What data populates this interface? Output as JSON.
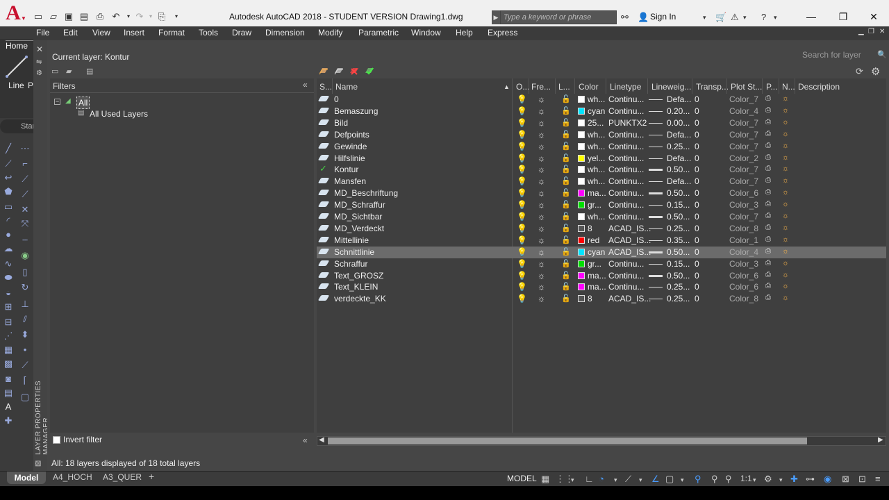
{
  "app": {
    "title": "Autodesk AutoCAD 2018 - STUDENT VERSION    Drawing1.dwg",
    "search_placeholder": "Type a keyword or phrase",
    "sign_in": "Sign In"
  },
  "menu": [
    "File",
    "Edit",
    "View",
    "Insert",
    "Format",
    "Tools",
    "Draw",
    "Dimension",
    "Modify",
    "Parametric",
    "Window",
    "Help",
    "Express"
  ],
  "ribbon": {
    "home_tab": "Home",
    "line_label": "Line",
    "p_label": "P",
    "start_tab": "Star"
  },
  "palette_title": "LAYER PROPERTIES MANAGER",
  "current_layer": "Current layer: Kontur",
  "layer_search_placeholder": "Search for layer",
  "filters": {
    "header": "Filters",
    "all": "All",
    "all_used": "All Used Layers",
    "invert_label": "Invert filter"
  },
  "columns": [
    "S...",
    "Name",
    "O...",
    "Fre...",
    "L...",
    "Color",
    "Linetype",
    "Lineweig...",
    "Transp...",
    "Plot St...",
    "P...",
    "N...",
    "Description"
  ],
  "layers": [
    {
      "name": "0",
      "color": "wh...",
      "hex": "#ffffff",
      "linetype": "Continu...",
      "lineweight": "Defa...",
      "thick": false,
      "transp": "0",
      "plot": "Color_7"
    },
    {
      "name": "Bemaszung",
      "color": "cyan",
      "hex": "#00e5ff",
      "linetype": "Continu...",
      "lineweight": "0.20...",
      "thick": false,
      "transp": "0",
      "plot": "Color_4"
    },
    {
      "name": "Bild",
      "color": "25...",
      "hex": "#ffffff",
      "linetype": "PUNKTX2",
      "lineweight": "0.00...",
      "thick": false,
      "transp": "0",
      "plot": "Color_7"
    },
    {
      "name": "Defpoints",
      "color": "wh...",
      "hex": "#ffffff",
      "linetype": "Continu...",
      "lineweight": "Defa...",
      "thick": false,
      "transp": "0",
      "plot": "Color_7"
    },
    {
      "name": "Gewinde",
      "color": "wh...",
      "hex": "#ffffff",
      "linetype": "Continu...",
      "lineweight": "0.25...",
      "thick": false,
      "transp": "0",
      "plot": "Color_7"
    },
    {
      "name": "Hilfslinie",
      "color": "yel...",
      "hex": "#ffff00",
      "linetype": "Continu...",
      "lineweight": "Defa...",
      "thick": false,
      "transp": "0",
      "plot": "Color_2"
    },
    {
      "name": "Kontur",
      "color": "wh...",
      "hex": "#ffffff",
      "linetype": "Continu...",
      "lineweight": "0.50...",
      "thick": true,
      "transp": "0",
      "plot": "Color_7",
      "current": true
    },
    {
      "name": "Mansfen",
      "color": "wh...",
      "hex": "#ffffff",
      "linetype": "Continu...",
      "lineweight": "Defa...",
      "thick": false,
      "transp": "0",
      "plot": "Color_7"
    },
    {
      "name": "MD_Beschriftung",
      "color": "ma...",
      "hex": "#ff00ff",
      "linetype": "Continu...",
      "lineweight": "0.50...",
      "thick": true,
      "transp": "0",
      "plot": "Color_6"
    },
    {
      "name": "MD_Schraffur",
      "color": "gr...",
      "hex": "#00e000",
      "linetype": "Continu...",
      "lineweight": "0.15...",
      "thick": false,
      "transp": "0",
      "plot": "Color_3"
    },
    {
      "name": "MD_Sichtbar",
      "color": "wh...",
      "hex": "#ffffff",
      "linetype": "Continu...",
      "lineweight": "0.50...",
      "thick": true,
      "transp": "0",
      "plot": "Color_7"
    },
    {
      "name": "MD_Verdeckt",
      "color": "8",
      "hex": "#555555",
      "linetype": "ACAD_IS...",
      "lineweight": "0.25...",
      "thick": false,
      "transp": "0",
      "plot": "Color_8"
    },
    {
      "name": "Mittellinie",
      "color": "red",
      "hex": "#ff0000",
      "linetype": "ACAD_IS...",
      "lineweight": "0.35...",
      "thick": false,
      "transp": "0",
      "plot": "Color_1"
    },
    {
      "name": "Schnittlinie",
      "color": "cyan",
      "hex": "#00e5ff",
      "linetype": "ACAD_IS...",
      "lineweight": "0.50...",
      "thick": true,
      "transp": "0",
      "plot": "Color_4",
      "selected": true
    },
    {
      "name": "Schraffur",
      "color": "gr...",
      "hex": "#00e000",
      "linetype": "Continu...",
      "lineweight": "0.15...",
      "thick": false,
      "transp": "0",
      "plot": "Color_3"
    },
    {
      "name": "Text_GROSZ",
      "color": "ma...",
      "hex": "#ff00ff",
      "linetype": "Continu...",
      "lineweight": "0.50...",
      "thick": true,
      "transp": "0",
      "plot": "Color_6"
    },
    {
      "name": "Text_KLEIN",
      "color": "ma...",
      "hex": "#ff00ff",
      "linetype": "Continu...",
      "lineweight": "0.25...",
      "thick": false,
      "transp": "0",
      "plot": "Color_6"
    },
    {
      "name": "verdeckte_KK",
      "color": "8",
      "hex": "#555555",
      "linetype": "ACAD_IS...",
      "lineweight": "0.25...",
      "thick": false,
      "transp": "0",
      "plot": "Color_8"
    }
  ],
  "status_text": "All: 18 layers displayed of 18 total layers",
  "bottom_tabs": [
    "Model",
    "A4_HOCH",
    "A3_QUER",
    "+"
  ],
  "model_button": "MODEL",
  "scale": "1:1"
}
